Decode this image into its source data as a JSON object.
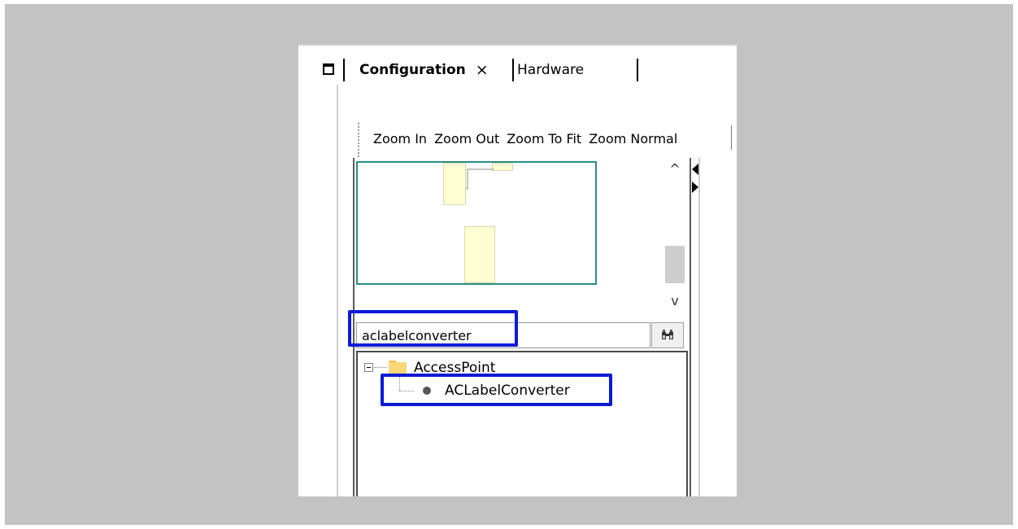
{
  "tabs": [
    {
      "label": "Configuration",
      "close": "×"
    },
    {
      "label": "Hardware"
    }
  ],
  "toolbar": {
    "zoom_in": "Zoom In",
    "zoom_out": "Zoom Out",
    "zoom_to_fit": "Zoom To Fit",
    "zoom_normal": "Zoom Normal"
  },
  "scroll": {
    "up": "^",
    "down": "v"
  },
  "search": {
    "value": "aclabelconverter"
  },
  "tree": {
    "root": {
      "label": "AccessPoint"
    },
    "child": {
      "label": "ACLabelConverter"
    }
  },
  "icons": {
    "maximize": "maximize-icon",
    "close": "close-icon",
    "search": "binoculars-icon",
    "folder": "folder-icon",
    "bean": "bean-icon"
  },
  "colors": {
    "highlight": "#0a1bd6",
    "overview_border": "#2e8b89",
    "node_fill": "#ffffd2"
  }
}
